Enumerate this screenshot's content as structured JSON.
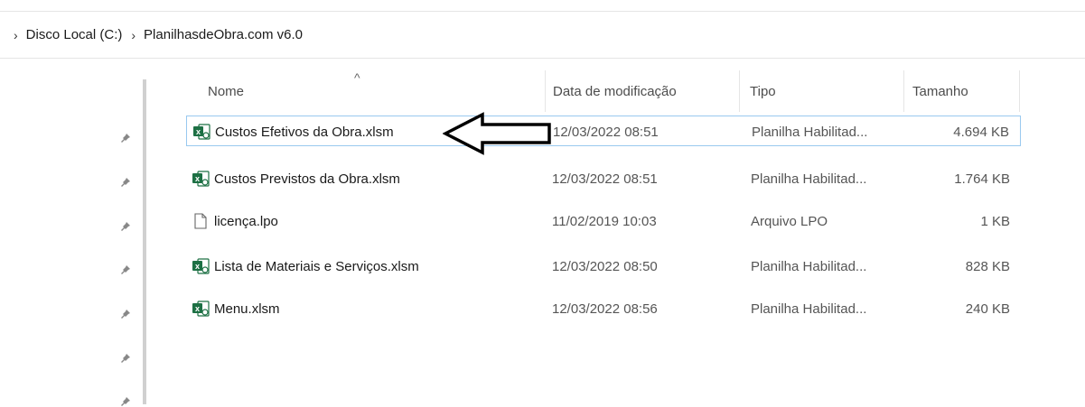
{
  "breadcrumb": {
    "items": [
      "Disco Local (C:)",
      "PlanilhasdeObra.com v6.0"
    ]
  },
  "columns": {
    "name": "Nome",
    "date": "Data de modificação",
    "type": "Tipo",
    "size": "Tamanho",
    "sort_indicator": "^"
  },
  "files": [
    {
      "name": "Custos Efetivos da Obra.xlsm",
      "date": "12/03/2022 08:51",
      "type": "Planilha Habilitad...",
      "size": "4.694 KB",
      "icon": "excel-macro-icon"
    },
    {
      "name": "Custos Previstos da Obra.xlsm",
      "date": "12/03/2022 08:51",
      "type": "Planilha Habilitad...",
      "size": "1.764 KB",
      "icon": "excel-macro-icon"
    },
    {
      "name": "licença.lpo",
      "date": "11/02/2019 10:03",
      "type": "Arquivo LPO",
      "size": "1 KB",
      "icon": "generic-file-icon"
    },
    {
      "name": "Lista de Materiais e Serviços.xlsm",
      "date": "12/03/2022 08:50",
      "type": "Planilha Habilitad...",
      "size": "828 KB",
      "icon": "excel-macro-icon"
    },
    {
      "name": "Menu.xlsm",
      "date": "12/03/2022 08:56",
      "type": "Planilha Habilitad...",
      "size": "240 KB",
      "icon": "excel-macro-icon"
    }
  ],
  "colors": {
    "focus_border": "#99c9ef",
    "excel_green": "#1d7044"
  }
}
